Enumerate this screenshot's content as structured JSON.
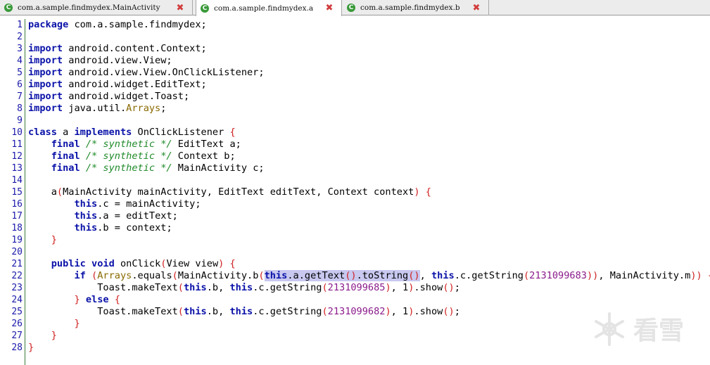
{
  "tabs": [
    {
      "label": "com.a.sample.findmydex.MainActivity",
      "icon": "class-icon",
      "active": false
    },
    {
      "label": "com.a.sample.findmydex.a",
      "icon": "class-icon",
      "active": true
    },
    {
      "label": "com.a.sample.findmydex.b",
      "icon": "class-icon",
      "active": false
    }
  ],
  "tab_icon_glyph": "C",
  "close_glyph": "✖",
  "watermark_text": "看雪",
  "colors": {
    "keyword": "#0a12a8",
    "comment": "#1f8a2a",
    "bracket": "#d02020",
    "close": "#d23c3c",
    "number": "#8a1a8a",
    "class_ref": "#8a6a00"
  },
  "lines": [
    [
      [
        "kw",
        "package"
      ],
      [
        "t",
        " com.a.sample.findmydex;"
      ]
    ],
    [],
    [
      [
        "kw",
        "import"
      ],
      [
        "t",
        " android.content.Context;"
      ]
    ],
    [
      [
        "kw",
        "import"
      ],
      [
        "t",
        " android.view.View;"
      ]
    ],
    [
      [
        "kw",
        "import"
      ],
      [
        "t",
        " android.view.View.OnClickListener;"
      ]
    ],
    [
      [
        "kw",
        "import"
      ],
      [
        "t",
        " android.widget.EditText;"
      ]
    ],
    [
      [
        "kw",
        "import"
      ],
      [
        "t",
        " android.widget.Toast;"
      ]
    ],
    [
      [
        "kw",
        "import"
      ],
      [
        "t",
        " java.util."
      ],
      [
        "cls",
        "Arrays"
      ],
      [
        "t",
        ";"
      ]
    ],
    [],
    [
      [
        "kw",
        "class"
      ],
      [
        "t",
        " a "
      ],
      [
        "kw",
        "implements"
      ],
      [
        "t",
        " OnClickListener "
      ],
      [
        "br",
        "{"
      ]
    ],
    [
      [
        "t",
        "    "
      ],
      [
        "kw",
        "final"
      ],
      [
        "t",
        " "
      ],
      [
        "cm",
        "/* synthetic */"
      ],
      [
        "t",
        " EditText a;"
      ]
    ],
    [
      [
        "t",
        "    "
      ],
      [
        "kw",
        "final"
      ],
      [
        "t",
        " "
      ],
      [
        "cm",
        "/* synthetic */"
      ],
      [
        "t",
        " Context b;"
      ]
    ],
    [
      [
        "t",
        "    "
      ],
      [
        "kw",
        "final"
      ],
      [
        "t",
        " "
      ],
      [
        "cm",
        "/* synthetic */"
      ],
      [
        "t",
        " MainActivity c;"
      ]
    ],
    [],
    [
      [
        "t",
        "    a"
      ],
      [
        "br",
        "("
      ],
      [
        "t",
        "MainActivity mainActivity, EditText editText, Context context"
      ],
      [
        "br",
        ")"
      ],
      [
        "t",
        " "
      ],
      [
        "br",
        "{"
      ]
    ],
    [
      [
        "t",
        "        "
      ],
      [
        "kw",
        "this"
      ],
      [
        "t",
        ".c = mainActivity;"
      ]
    ],
    [
      [
        "t",
        "        "
      ],
      [
        "kw",
        "this"
      ],
      [
        "t",
        ".a = editText;"
      ]
    ],
    [
      [
        "t",
        "        "
      ],
      [
        "kw",
        "this"
      ],
      [
        "t",
        ".b = context;"
      ]
    ],
    [
      [
        "t",
        "    "
      ],
      [
        "br",
        "}"
      ]
    ],
    [],
    [
      [
        "t",
        "    "
      ],
      [
        "kw",
        "public"
      ],
      [
        "t",
        " "
      ],
      [
        "kw",
        "void"
      ],
      [
        "t",
        " onClick"
      ],
      [
        "br",
        "("
      ],
      [
        "t",
        "View view"
      ],
      [
        "br",
        ")"
      ],
      [
        "t",
        " "
      ],
      [
        "br",
        "{"
      ]
    ],
    [
      [
        "t",
        "        "
      ],
      [
        "kw",
        "if"
      ],
      [
        "t",
        " "
      ],
      [
        "br",
        "("
      ],
      [
        "cls",
        "Arrays"
      ],
      [
        "t",
        ".equals"
      ],
      [
        "br",
        "("
      ],
      [
        "t",
        "MainActivity.b"
      ],
      [
        "br",
        "("
      ],
      [
        "kw-hl",
        "this"
      ],
      [
        "hl",
        ".a.getText"
      ],
      [
        "br-hl",
        "()"
      ],
      [
        "hl",
        ".toString"
      ],
      [
        "br-hl",
        "()"
      ],
      [
        "t",
        ", "
      ],
      [
        "kw",
        "this"
      ],
      [
        "t",
        ".c.getString"
      ],
      [
        "br",
        "("
      ],
      [
        "num",
        "2131099683"
      ],
      [
        "br",
        "))"
      ],
      [
        "t",
        ", MainActivity.m"
      ],
      [
        "br",
        "))"
      ],
      [
        "t",
        " "
      ],
      [
        "br",
        "{"
      ]
    ],
    [
      [
        "t",
        "            Toast.makeText"
      ],
      [
        "br",
        "("
      ],
      [
        "kw",
        "this"
      ],
      [
        "t",
        ".b, "
      ],
      [
        "kw",
        "this"
      ],
      [
        "t",
        ".c.getString"
      ],
      [
        "br",
        "("
      ],
      [
        "num",
        "2131099685"
      ],
      [
        "br",
        ")"
      ],
      [
        "t",
        ", 1"
      ],
      [
        "br",
        ")"
      ],
      [
        "t",
        ".show"
      ],
      [
        "br",
        "()"
      ],
      [
        "t",
        ";"
      ]
    ],
    [
      [
        "t",
        "        "
      ],
      [
        "br",
        "}"
      ],
      [
        "t",
        " "
      ],
      [
        "kw",
        "else"
      ],
      [
        "t",
        " "
      ],
      [
        "br",
        "{"
      ]
    ],
    [
      [
        "t",
        "            Toast.makeText"
      ],
      [
        "br",
        "("
      ],
      [
        "kw",
        "this"
      ],
      [
        "t",
        ".b, "
      ],
      [
        "kw",
        "this"
      ],
      [
        "t",
        ".c.getString"
      ],
      [
        "br",
        "("
      ],
      [
        "num",
        "2131099682"
      ],
      [
        "br",
        ")"
      ],
      [
        "t",
        ", 1"
      ],
      [
        "br",
        ")"
      ],
      [
        "t",
        ".show"
      ],
      [
        "br",
        "()"
      ],
      [
        "t",
        ";"
      ]
    ],
    [
      [
        "t",
        "        "
      ],
      [
        "br",
        "}"
      ]
    ],
    [
      [
        "t",
        "    "
      ],
      [
        "br",
        "}"
      ]
    ],
    [
      [
        "br",
        "}"
      ]
    ]
  ]
}
